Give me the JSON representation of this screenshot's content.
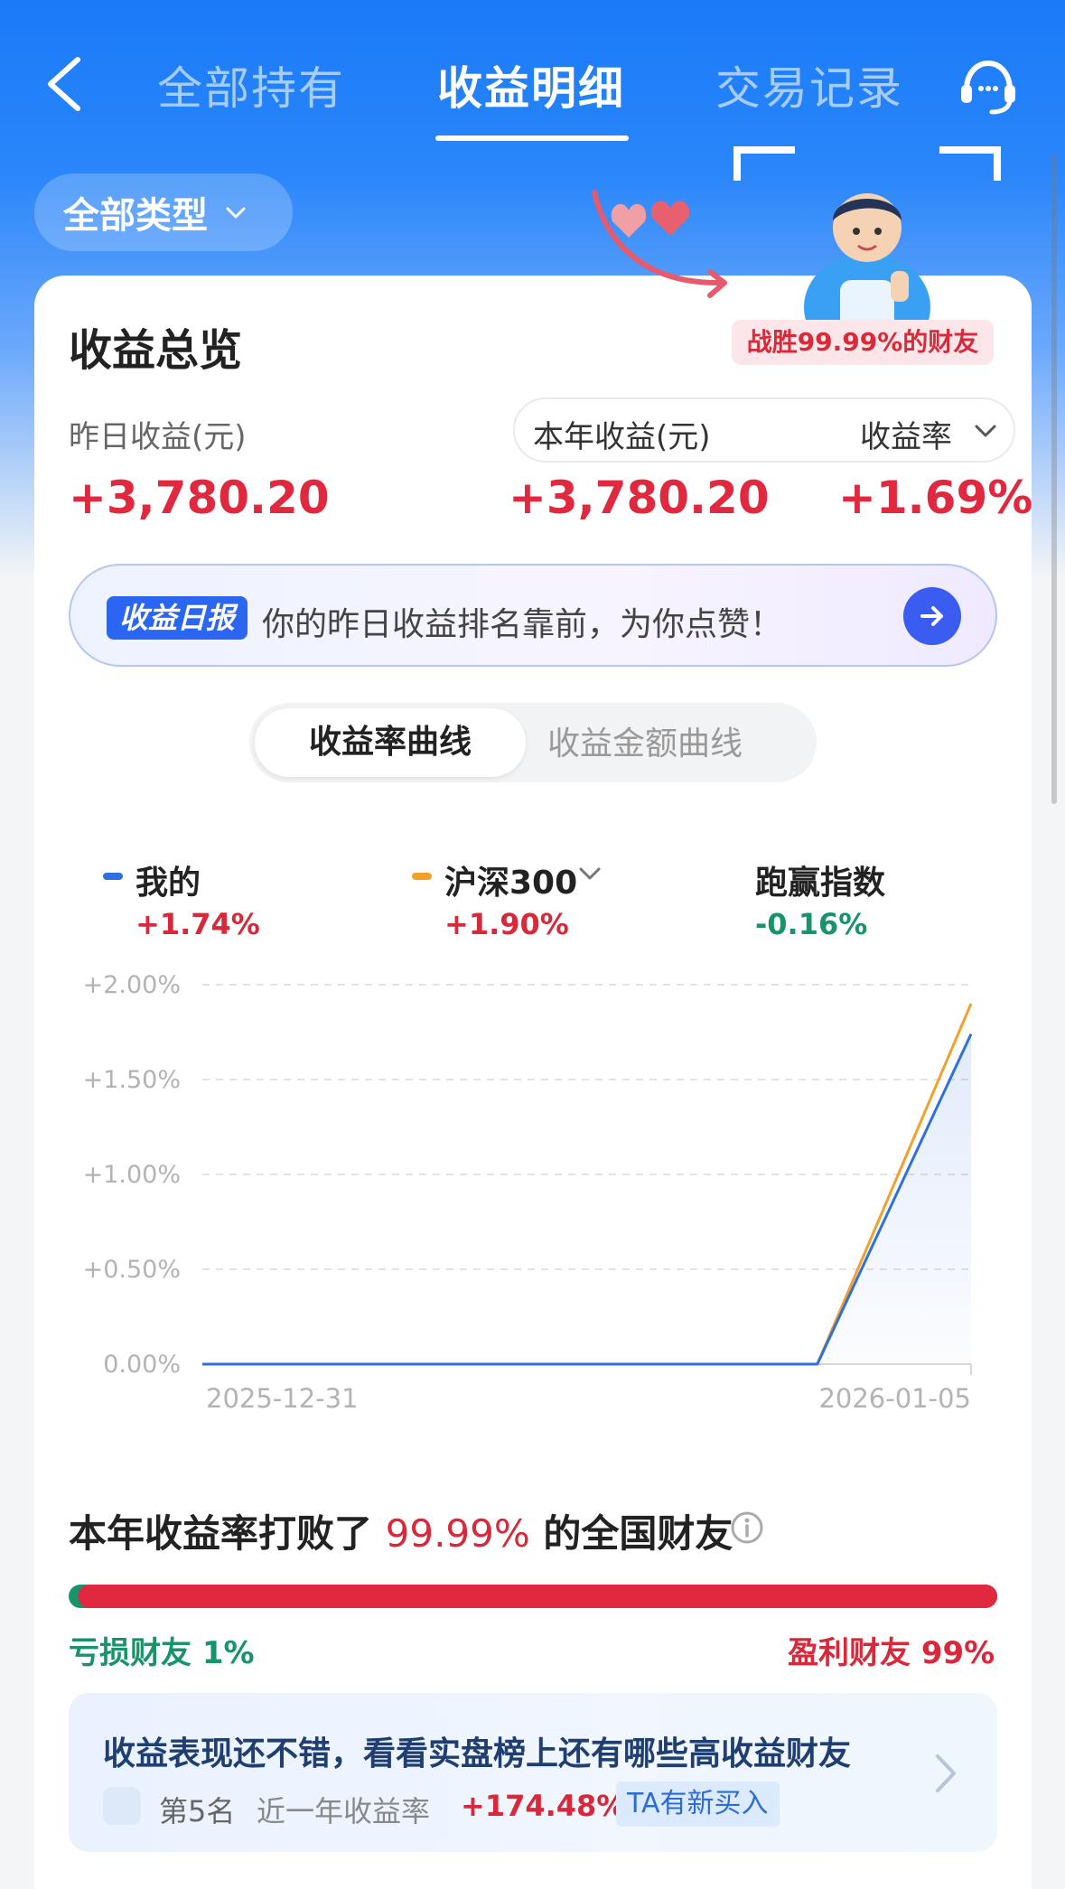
{
  "header": {
    "tabs": [
      {
        "label": "全部持有",
        "active": false
      },
      {
        "label": "收益明细",
        "active": true
      },
      {
        "label": "交易记录",
        "active": false
      }
    ],
    "back_icon": "chevron-left-icon",
    "service_icon": "customer-service-icon"
  },
  "filter": {
    "label": "全部类型"
  },
  "overview": {
    "title": "收益总览",
    "yesterday_label": "昨日收益(元)",
    "yesterday_value": "+3,780.20",
    "year_label": "本年收益(元)",
    "year_value": "+3,780.20",
    "rate_label": "收益率",
    "rate_value": "+1.69%"
  },
  "badge": {
    "text": "战胜99.99%的财友"
  },
  "daily_report": {
    "tag": "收益日报",
    "text": "你的昨日收益排名靠前，为你点赞！"
  },
  "segment": {
    "options": [
      "收益率曲线",
      "收益金额曲线"
    ],
    "selected": "收益率曲线"
  },
  "legend": {
    "mine": {
      "name": "我的",
      "value": "+1.74%",
      "color": "#2f6fe0"
    },
    "index": {
      "name": "沪深300",
      "value": "+1.90%",
      "color": "#f2a22a"
    },
    "beat": {
      "name": "跑赢指数",
      "value": "-0.16%"
    }
  },
  "chart_data": {
    "type": "line",
    "x": [
      "2025-12-31",
      "2026-01-05"
    ],
    "x_tick_labels": [
      "2025-12-31",
      "2026-01-05"
    ],
    "y_tick_labels": [
      "+2.00%",
      "+1.50%",
      "+1.00%",
      "+0.50%",
      "0.00%"
    ],
    "ylim": [
      0,
      2.0
    ],
    "grid": true,
    "series": [
      {
        "name": "我的",
        "points": [
          [
            0,
            0
          ],
          [
            0.8,
            0
          ],
          [
            1,
            1.74
          ]
        ],
        "color": "#2f6fe0"
      },
      {
        "name": "沪深300",
        "points": [
          [
            0,
            0
          ],
          [
            0.8,
            0
          ],
          [
            1,
            1.9
          ]
        ],
        "color": "#f2a22a"
      }
    ]
  },
  "beat_section": {
    "prefix": "本年收益率打败了",
    "highlight": "99.99%",
    "suffix": "的全国财友",
    "loss_label": "亏损财友 1%",
    "win_label": "盈利财友 99%",
    "win_ratio": 0.99
  },
  "promo": {
    "title": "收益表现还不错，看看实盘榜上还有哪些高收益财友",
    "rank": "第5名",
    "rate_label": "近一年收益率",
    "rate_value": "+174.48%",
    "tag": "TA有新买入"
  },
  "colors": {
    "accent": "#1a7af8",
    "up": "#d9283a",
    "down": "#18936b"
  }
}
